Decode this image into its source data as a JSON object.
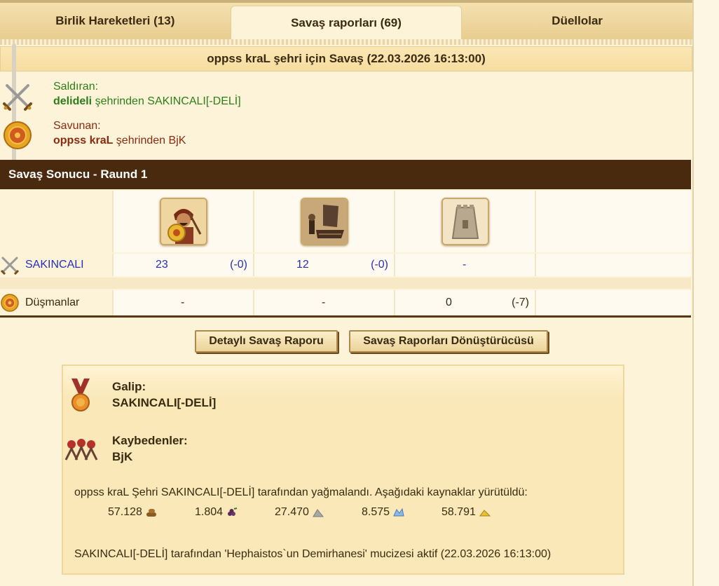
{
  "tabs": [
    {
      "label": "Birlik Hareketleri (13)",
      "active": false
    },
    {
      "label": "Savaş raporları (69)",
      "active": true
    },
    {
      "label": "Düellolar",
      "active": false
    }
  ],
  "report": {
    "title": "oppss kraL şehri için Savaş (22.03.2026 16:13:00)",
    "attacker_label": "Saldıran:",
    "attacker_city": "delideli",
    "attacker_rest": " şehrinden SAKINCALI[-DELİ]",
    "defender_label": "Savunan:",
    "defender_city": "oppss kraL",
    "defender_rest": " şehrinden BjK"
  },
  "round": {
    "title": "Savaş Sonucu - Raund 1"
  },
  "units": [
    "hoplite-unit-icon",
    "catapult-unit-icon",
    "wall-unit-icon"
  ],
  "rows": {
    "own": {
      "name": "SAKINCALI",
      "u1_count": "23",
      "u1_loss": "(-0)",
      "u2_count": "12",
      "u2_loss": "(-0)",
      "u3": "-"
    },
    "enemy": {
      "name": "Düşmanlar",
      "u1": "-",
      "u2": "-",
      "u3_count": "0",
      "u3_loss": "(-7)"
    }
  },
  "buttons": {
    "detailed": "Detaylı Savaş Raporu",
    "converter": "Savaş Raporları Dönüştürücüsü"
  },
  "result": {
    "winner_label": "Galip:",
    "winner": "SAKINCALI[-DELİ]",
    "losers_label": "Kaybedenler:",
    "losers": "BjK",
    "looted_text": "oppss kraL Şehri SAKINCALI[-DELİ] tarafından yağmalandı. Aşağıdaki kaynaklar yürütüldü:",
    "resources": [
      {
        "value": "57.128",
        "icon": "wood-icon"
      },
      {
        "value": "1.804",
        "icon": "wine-icon"
      },
      {
        "value": "27.470",
        "icon": "marble-icon"
      },
      {
        "value": "8.575",
        "icon": "crystal-icon"
      },
      {
        "value": "58.791",
        "icon": "sulfur-icon"
      }
    ],
    "wonder_text": "SAKINCALI[-DELİ] tarafından 'Hephaistos`un Demirhanesi' mucizesi aktif (22.03.2026 16:13:00)"
  },
  "colors": {
    "attacker": "#2e7d18",
    "defender": "#8a2a10",
    "own_row_text": "#2630b8",
    "round_bar": "#4a2a0e"
  }
}
